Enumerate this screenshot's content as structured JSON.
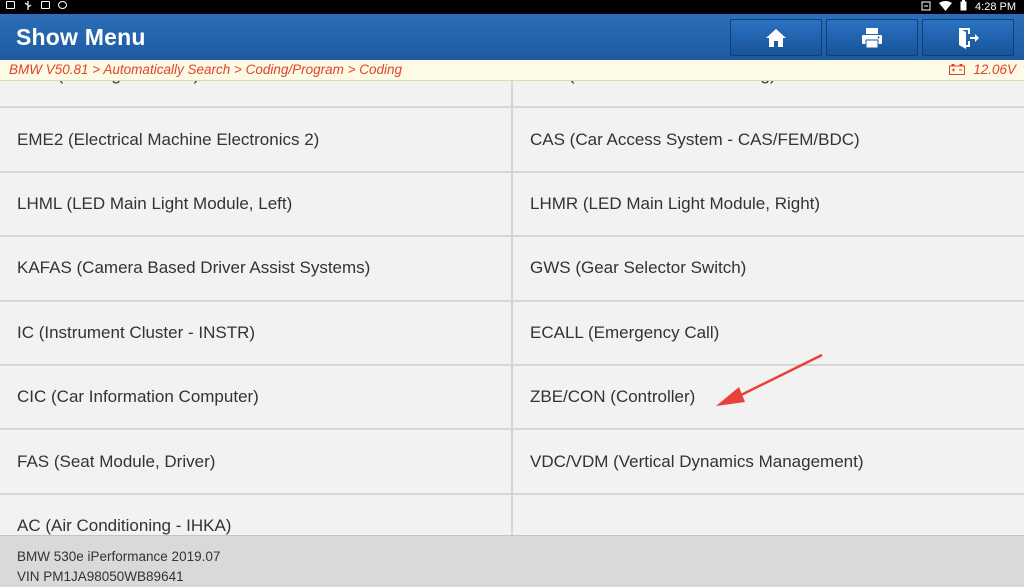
{
  "status_bar": {
    "time": "4:28 PM",
    "left_icons": [
      "notification-icon",
      "usb-icon",
      "media-icon",
      "bluetooth-icon"
    ],
    "right_icons": [
      "battery-saver-icon",
      "wifi-icon",
      "battery-icon"
    ]
  },
  "header": {
    "title": "Show Menu",
    "buttons": [
      "home-icon",
      "print-icon",
      "exit-icon"
    ],
    "color": "#2366ae"
  },
  "breadcrumb": {
    "path": "BMW V50.81 > Automatically Search > Coding/Program > Coding",
    "voltage": "12.06V",
    "color": "#e0432a"
  },
  "modules": [
    "PMA (Parking Assistant)",
    "EPS (Electronic Power Steering)",
    "EME2 (Electrical Machine Electronics 2)",
    "CAS (Car Access System - CAS/FEM/BDC)",
    "LHML (LED Main Light Module, Left)",
    "LHMR (LED Main Light Module, Right)",
    "KAFAS (Camera Based Driver Assist Systems)",
    "GWS (Gear Selector Switch)",
    "IC (Instrument Cluster - INSTR)",
    "ECALL (Emergency Call)",
    "CIC (Car Information Computer)",
    "ZBE/CON (Controller)",
    "FAS (Seat Module, Driver)",
    "VDC/VDM (Vertical Dynamics Management)",
    "AC (Air Conditioning - IHKA)",
    ""
  ],
  "footer": {
    "vehicle": "BMW 530e iPerformance 2019.07",
    "vin": "VIN PM1JA98050WB89641"
  },
  "annotation": {
    "arrow_color": "#e8413a"
  }
}
